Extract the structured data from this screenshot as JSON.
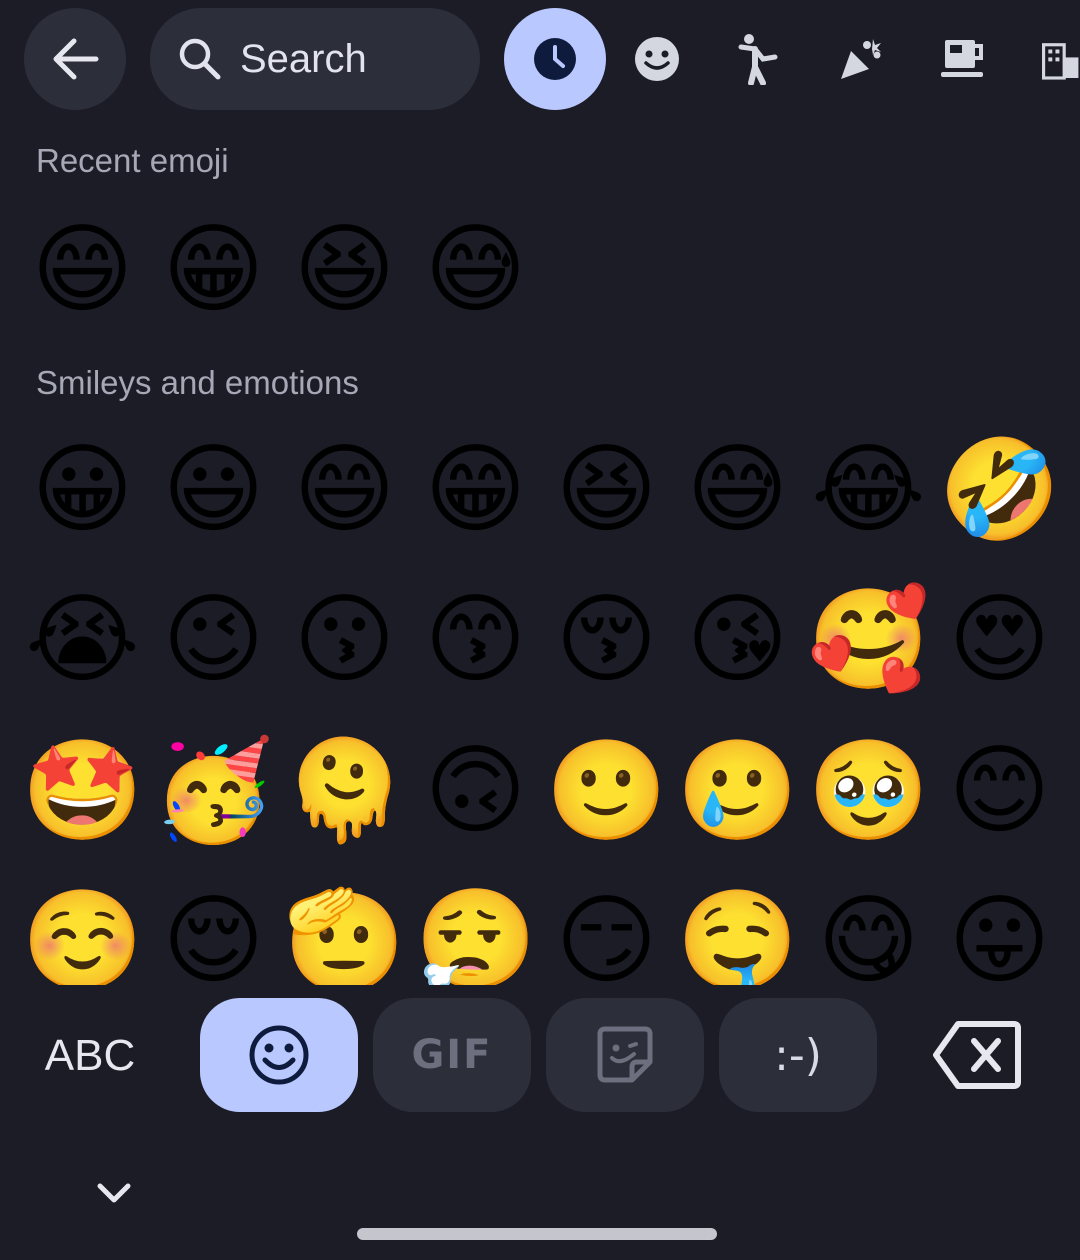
{
  "header": {
    "search_label": "Search",
    "category_tabs": [
      "clock-icon",
      "smiley-icon",
      "person-icon",
      "party-popper-icon",
      "coffee-cup-icon",
      "buildings-icon"
    ]
  },
  "sections": {
    "recent": {
      "title": "Recent emoji",
      "emojis": [
        "😄",
        "😁",
        "😆",
        "😅"
      ]
    },
    "smileys": {
      "title": "Smileys and emotions",
      "rows": [
        [
          "😀",
          "😃",
          "😄",
          "😁",
          "😆",
          "😅",
          "😂",
          "🤣"
        ],
        [
          "😭",
          "😉",
          "😗",
          "😙",
          "😚",
          "😘",
          "🥰",
          "😍"
        ],
        [
          "🤩",
          "🥳",
          "🫠",
          "🙃",
          "🙂",
          "🥲",
          "🥹",
          "😊"
        ],
        [
          "☺️",
          "😌",
          "🫡",
          "😮‍💨",
          "😏",
          "🤤",
          "😋",
          "😛"
        ]
      ]
    }
  },
  "bottom_bar": {
    "abc_label": "ABC",
    "gif_label": "GIF",
    "emoticon_label": ":-)"
  },
  "colors": {
    "background": "#1b1c26",
    "surface": "#2c2e3a",
    "accent": "#b9c8ff",
    "accent_dark": "#0f1b3d",
    "section_text": "#a6a8b6"
  }
}
